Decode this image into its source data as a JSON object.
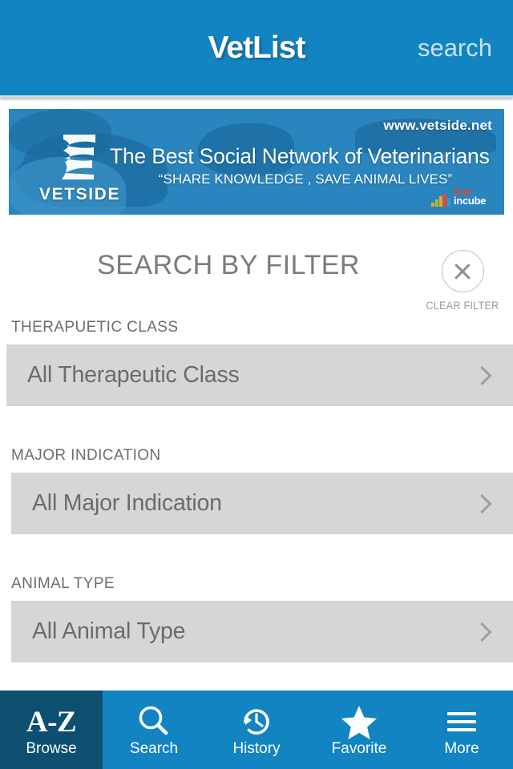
{
  "header": {
    "title": "VetList",
    "search_label": "search",
    "bg_color": "#1384c2"
  },
  "banner": {
    "url": "www.vetside.net",
    "headline": "The Best Social Network of Veterinarians",
    "subtitle": "“SHARE KNOWLEDGE , SAVE ANIMAL LIVES”",
    "logo_text": "VETSIDE",
    "sponsor_top": "true",
    "sponsor_bottom": "incube",
    "bg_color": "#2a84bd"
  },
  "filter_panel": {
    "title": "SEARCH BY FILTER",
    "clear_label": "CLEAR FILTER",
    "groups": [
      {
        "label": "THERAPUETIC CLASS",
        "value": "All Therapeutic Class"
      },
      {
        "label": "MAJOR INDICATION",
        "value": "All Major Indication"
      },
      {
        "label": "ANIMAL TYPE",
        "value": "All Animal Type"
      }
    ]
  },
  "bottom_nav": {
    "active_index": 0,
    "active_bg": "#0d4f70",
    "items": [
      {
        "label": "Browse",
        "icon": "a-z-icon",
        "glyph": "A-Z"
      },
      {
        "label": "Search",
        "icon": "search-icon",
        "glyph": ""
      },
      {
        "label": "History",
        "icon": "history-icon",
        "glyph": ""
      },
      {
        "label": "Favorite",
        "icon": "star-icon",
        "glyph": ""
      },
      {
        "label": "More",
        "icon": "hamburger-icon",
        "glyph": ""
      }
    ]
  }
}
